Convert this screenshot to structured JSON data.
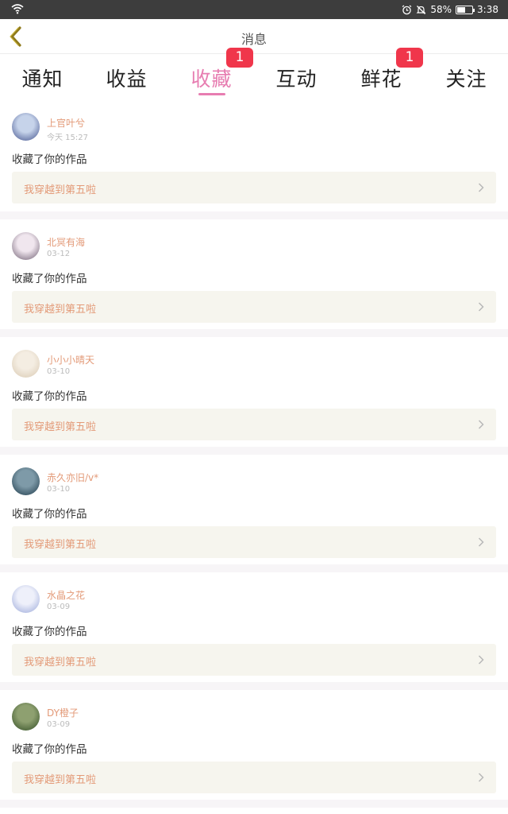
{
  "status_bar": {
    "battery_text": "58%",
    "battery_level": 0.58,
    "time": "3:38",
    "icons": [
      "wifi-icon",
      "alarm-icon",
      "mute-icon",
      "battery-icon"
    ]
  },
  "header": {
    "title": "消息",
    "back_icon": "chevron-left-icon"
  },
  "tabs": [
    {
      "label": "通知",
      "active": false,
      "badge": ""
    },
    {
      "label": "收益",
      "active": false,
      "badge": ""
    },
    {
      "label": "收藏",
      "active": true,
      "badge": "1"
    },
    {
      "label": "互动",
      "active": false,
      "badge": ""
    },
    {
      "label": "鲜花",
      "active": false,
      "badge": "1"
    },
    {
      "label": "关注",
      "active": false,
      "badge": ""
    }
  ],
  "colors": {
    "accent": "#e77db1",
    "name": "#e39a78",
    "badge": "#f0364b",
    "card_bg": "#f6f5ee"
  },
  "notifications": [
    {
      "user": "上官叶兮",
      "time": "今天 15:27",
      "action": "收藏了你的作品",
      "work": "我穿越到第五啦",
      "avatar_colors": [
        "#3f4f8a",
        "#c6d3ea"
      ]
    },
    {
      "user": "北冥有海",
      "time": "03-12",
      "action": "收藏了你的作品",
      "work": "我穿越到第五啦",
      "avatar_colors": [
        "#6b5b6e",
        "#f0e6ee"
      ]
    },
    {
      "user": "小小小晴天",
      "time": "03-10",
      "action": "收藏了你的作品",
      "work": "我穿越到第五啦",
      "avatar_colors": [
        "#d8c8b0",
        "#f4ede2"
      ]
    },
    {
      "user": "赤久亦旧/v*",
      "time": "03-10",
      "action": "收藏了你的作品",
      "work": "我穿越到第五啦",
      "avatar_colors": [
        "#1c3848",
        "#7e9aa8"
      ]
    },
    {
      "user": "水晶之花",
      "time": "03-09",
      "action": "收藏了你的作品",
      "work": "我穿越到第五啦",
      "avatar_colors": [
        "#98a6d8",
        "#eef0fa"
      ]
    },
    {
      "user": "DY橙子",
      "time": "03-09",
      "action": "收藏了你的作品",
      "work": "我穿越到第五啦",
      "avatar_colors": [
        "#2e4a22",
        "#8ea070"
      ]
    }
  ]
}
